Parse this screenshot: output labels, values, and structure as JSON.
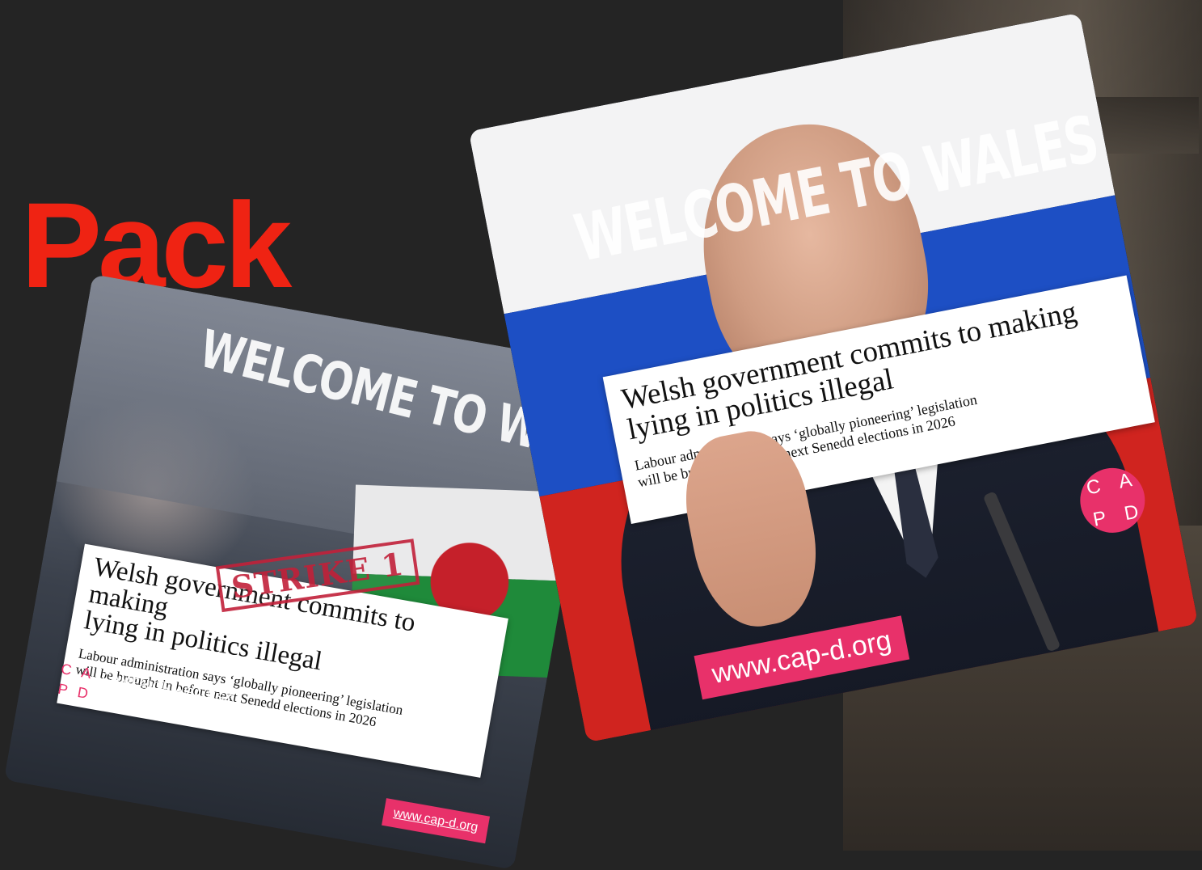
{
  "page_title": "Pack",
  "colors": {
    "title_red": "#ef2313",
    "brand_pink": "#e8316a",
    "background": "#242424"
  },
  "card_left": {
    "banner": "WELCOME TO WALES",
    "stamp": "STRIKE 1",
    "headline_line1": "Welsh government commits to making",
    "headline_line2": "lying in politics illegal",
    "subline_line1": "Labour administration says ‘globally pioneering’ legislation",
    "subline_line2": "will be brought in before next Senedd elections in 2026",
    "logo_letters": [
      "C",
      "A",
      "P",
      "D"
    ],
    "org_line1": "CAMPAIGN AGAINST",
    "org_line2": "POLITICAL DECEPTION",
    "url": "www.cap-d.org"
  },
  "card_right": {
    "banner": "WELCOME TO WALES",
    "headline_line1": "Welsh government commits to making",
    "headline_line2": "lying in politics illegal",
    "subline_line1": "Labour administration says ‘globally pioneering’ legislation",
    "subline_line2": "will be brought in before next Senedd elections in 2026",
    "logo_letters": [
      "C",
      "A",
      "P",
      "D"
    ],
    "url": "www.cap-d.org"
  }
}
